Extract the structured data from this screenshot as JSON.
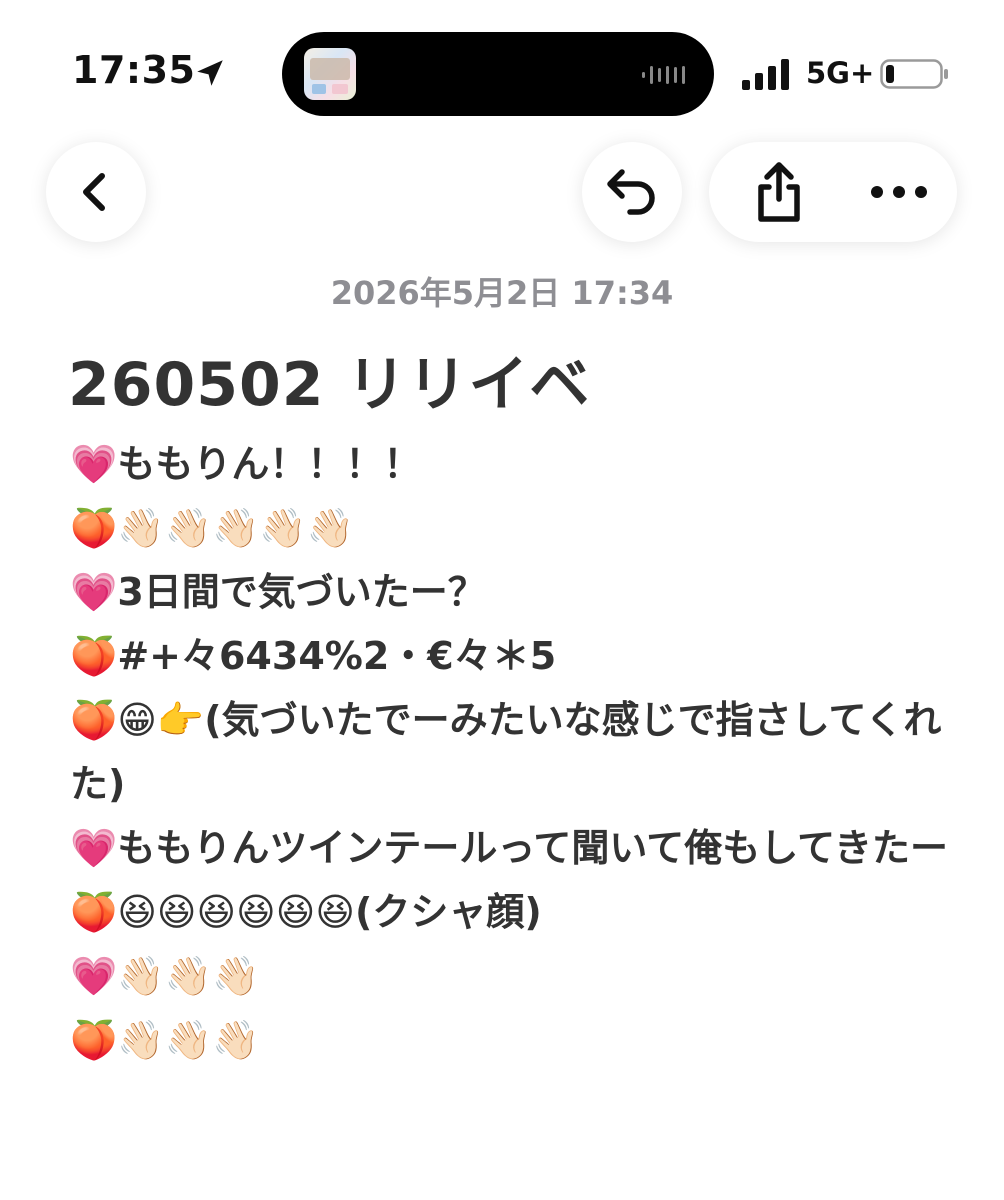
{
  "status_bar": {
    "time": "17:35",
    "network": "5G+",
    "icons": [
      "location-arrow-icon",
      "signal-bars-icon",
      "battery-icon"
    ]
  },
  "nav": {
    "back_icon": "chevron-left-icon",
    "undo_icon": "undo-arrow-icon",
    "share_icon": "share-icon",
    "more_icon": "ellipsis-icon"
  },
  "note": {
    "date": "2026年5月2日 17:34",
    "title": "260502 リリイベ",
    "lines": [
      "💗ももりん！！！！",
      "🍑👋🏻👋🏻👋🏻👋🏻👋🏻",
      "💗3日間で気づいたー？",
      "🍑#+々6434%2・€々＊5",
      "🍑😁👉(気づいたでーみたいな感じで指さしてくれた)",
      "💗ももりんツインテールって聞いて俺もしてきたー",
      "🍑😆😆😆😆😆😆(クシャ顔)",
      "💗👋🏻👋🏻👋🏻",
      "🍑👋🏻👋🏻👋🏻"
    ]
  },
  "colors": {
    "background": "#ffffff",
    "date_text": "#8e8e93",
    "body_text": "#333333"
  }
}
